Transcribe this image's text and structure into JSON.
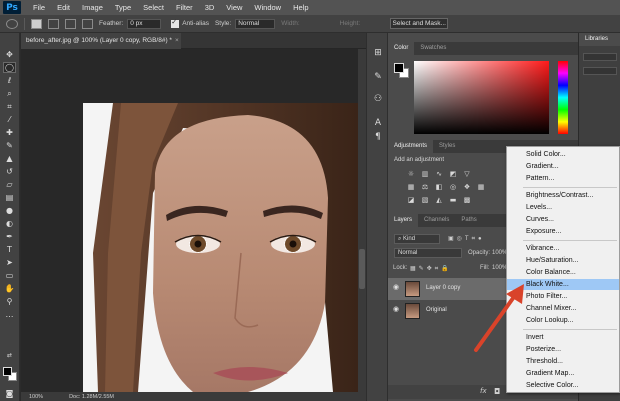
{
  "app": {
    "logo": "Ps"
  },
  "menu": [
    "File",
    "Edit",
    "Image",
    "Type",
    "Select",
    "Filter",
    "3D",
    "View",
    "Window",
    "Help"
  ],
  "options": {
    "feather_label": "Feather:",
    "feather_value": "0 px",
    "antialias_label": "Anti-alias",
    "style_label": "Style:",
    "style_value": "Normal",
    "width_label": "Width:",
    "height_label": "Height:",
    "select_mask": "Select and Mask..."
  },
  "document": {
    "tab_title": "before_after.jpg @ 100% (Layer 0 copy, RGB/8#) *",
    "close": "×",
    "zoom": "100%",
    "doc_size": "Doc: 1.28M/2.55M"
  },
  "color_panel": {
    "tabs": [
      "Color",
      "Swatches"
    ],
    "fg_color": "#000000",
    "bg_color": "#ffffff",
    "hue": "#ff1a1a"
  },
  "adjustments_panel": {
    "tabs": [
      "Adjustments",
      "Styles"
    ],
    "title": "Add an adjustment"
  },
  "layers_panel": {
    "tabs": [
      "Layers",
      "Channels",
      "Paths"
    ],
    "kind": "Kind",
    "blend_mode": "Normal",
    "opacity_label": "Opacity:",
    "opacity_value": "100%",
    "lock_label": "Lock:",
    "fill_label": "Fill:",
    "fill_value": "100%",
    "layers": [
      {
        "name": "Layer 0 copy",
        "selected": true
      },
      {
        "name": "Original",
        "selected": false
      }
    ],
    "fx": "fx"
  },
  "libraries": {
    "title": "Libraries"
  },
  "adjustment_menu": {
    "items": [
      "Solid Color...",
      "Gradient...",
      "Pattern...",
      "Brightness/Contrast...",
      "Levels...",
      "Curves...",
      "Exposure...",
      "Vibrance...",
      "Hue/Saturation...",
      "Color Balance...",
      "Black  White...",
      "Photo Filter...",
      "Channel Mixer...",
      "Color Lookup...",
      "Invert",
      "Posterize...",
      "Threshold...",
      "Gradient Map...",
      "Selective Color..."
    ],
    "highlighted": "Black  White..."
  },
  "annotation": {
    "arrow_color": "#d9432a"
  }
}
